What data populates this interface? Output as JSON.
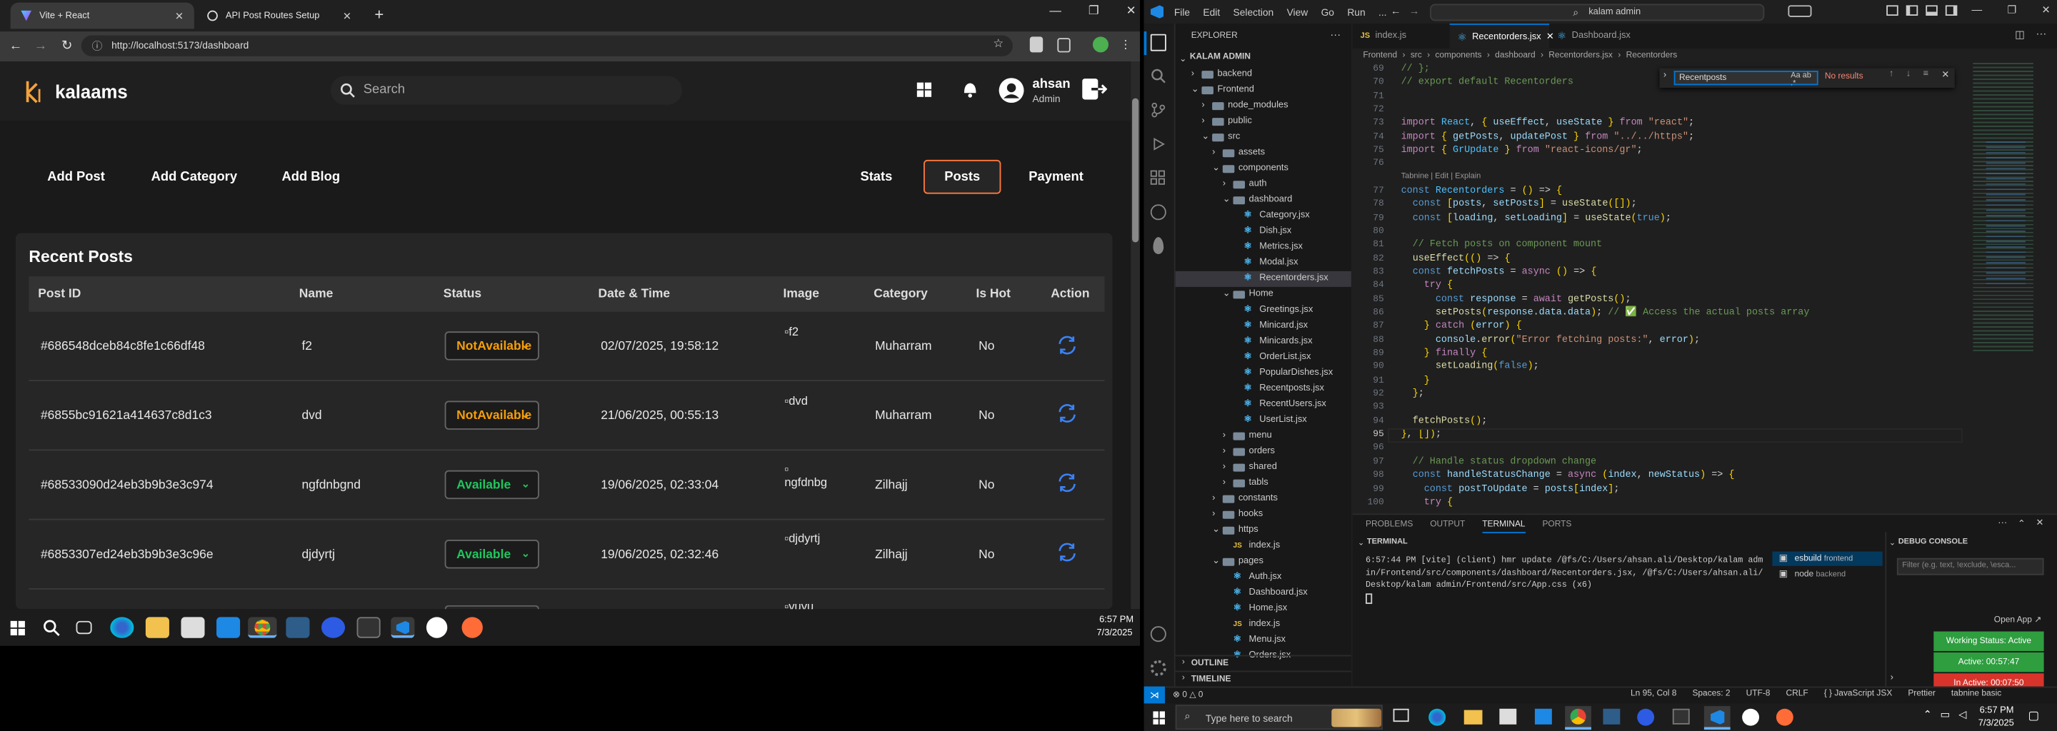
{
  "browser": {
    "tabs": [
      {
        "label": "Vite + React"
      },
      {
        "label": "API Post Routes Setup"
      }
    ],
    "url": "http://localhost:5173/dashboard"
  },
  "app": {
    "brand": "kalaams",
    "search_placeholder": "Search",
    "user_name": "ahsan",
    "user_role": "Admin",
    "left_nav": [
      "Add Post",
      "Add Category",
      "Add Blog"
    ],
    "right_nav": [
      "Stats",
      "Posts",
      "Payment"
    ],
    "active_nav": "Posts",
    "section_title": "Recent Posts",
    "columns": [
      "Post ID",
      "Name",
      "Status",
      "Date & Time",
      "Image",
      "Category",
      "Is Hot",
      "Action"
    ],
    "rows": [
      {
        "id": "#686548dceb84c8fe1c66df48",
        "name": "f2",
        "status": "NotAvailable",
        "datetime": "02/07/2025, 19:58:12",
        "image_alt": "f2",
        "category": "Muharram",
        "hot": "No"
      },
      {
        "id": "#6855bc91621a414637c8d1c3",
        "name": "dvd",
        "status": "NotAvailable",
        "datetime": "21/06/2025, 00:55:13",
        "image_alt": "dvd",
        "category": "Muharram",
        "hot": "No"
      },
      {
        "id": "#68533090d24eb3b9b3e3c974",
        "name": "ngfdnbgnd",
        "status": "Available",
        "datetime": "19/06/2025, 02:33:04",
        "image_alt": "ngfdnbg",
        "category": "Zilhajj",
        "hot": "No"
      },
      {
        "id": "#6853307ed24eb3b9b3e3c96e",
        "name": "djdyrtj",
        "status": "Available",
        "datetime": "19/06/2025, 02:32:46",
        "image_alt": "djdyrtj",
        "category": "Zilhajj",
        "hot": "No"
      }
    ],
    "partial_row_image_alt": "yuyu",
    "colors": {
      "available": "#22c55e",
      "not_available": "#f59e0b",
      "accent": "#ff7a3d",
      "refresh": "#3b82f6"
    }
  },
  "taskbar_left": {
    "time": "6:57 PM",
    "date": "7/3/2025"
  },
  "vscode": {
    "menu": [
      "File",
      "Edit",
      "Selection",
      "View",
      "Go",
      "Run",
      "..."
    ],
    "search": "kalam admin",
    "tabs": [
      {
        "label": "index.js"
      },
      {
        "label": "Recentorders.jsx"
      },
      {
        "label": "Dashboard.jsx"
      }
    ],
    "breadcrumb": [
      "Frontend",
      "src",
      "components",
      "dashboard",
      "Recentorders.jsx",
      "Recentorders"
    ],
    "explorer_title": "EXPLORER",
    "root": "KALAM ADMIN",
    "tree": [
      {
        "label": "backend",
        "depth": 1,
        "kind": "folder",
        "open": false
      },
      {
        "label": "Frontend",
        "depth": 1,
        "kind": "folder",
        "open": true
      },
      {
        "label": "node_modules",
        "depth": 2,
        "kind": "folder",
        "open": false
      },
      {
        "label": "public",
        "depth": 2,
        "kind": "folder",
        "open": false
      },
      {
        "label": "src",
        "depth": 2,
        "kind": "folder",
        "open": true
      },
      {
        "label": "assets",
        "depth": 3,
        "kind": "folder",
        "open": false
      },
      {
        "label": "components",
        "depth": 3,
        "kind": "folder",
        "open": true
      },
      {
        "label": "auth",
        "depth": 4,
        "kind": "folder",
        "open": false
      },
      {
        "label": "dashboard",
        "depth": 4,
        "kind": "folder",
        "open": true
      },
      {
        "label": "Category.jsx",
        "depth": 5,
        "kind": "file"
      },
      {
        "label": "Dish.jsx",
        "depth": 5,
        "kind": "file"
      },
      {
        "label": "Metrics.jsx",
        "depth": 5,
        "kind": "file"
      },
      {
        "label": "Modal.jsx",
        "depth": 5,
        "kind": "file"
      },
      {
        "label": "Recentorders.jsx",
        "depth": 5,
        "kind": "file",
        "selected": true
      },
      {
        "label": "Home",
        "depth": 4,
        "kind": "folder",
        "open": true
      },
      {
        "label": "Greetings.jsx",
        "depth": 5,
        "kind": "file"
      },
      {
        "label": "Minicard.jsx",
        "depth": 5,
        "kind": "file"
      },
      {
        "label": "Minicards.jsx",
        "depth": 5,
        "kind": "file"
      },
      {
        "label": "OrderList.jsx",
        "depth": 5,
        "kind": "file"
      },
      {
        "label": "PopularDishes.jsx",
        "depth": 5,
        "kind": "file"
      },
      {
        "label": "Recentposts.jsx",
        "depth": 5,
        "kind": "file"
      },
      {
        "label": "RecentUsers.jsx",
        "depth": 5,
        "kind": "file"
      },
      {
        "label": "UserList.jsx",
        "depth": 5,
        "kind": "file"
      },
      {
        "label": "menu",
        "depth": 4,
        "kind": "folder",
        "open": false
      },
      {
        "label": "orders",
        "depth": 4,
        "kind": "folder",
        "open": false
      },
      {
        "label": "shared",
        "depth": 4,
        "kind": "folder",
        "open": false
      },
      {
        "label": "tabls",
        "depth": 4,
        "kind": "folder",
        "open": false
      },
      {
        "label": "constants",
        "depth": 3,
        "kind": "folder",
        "open": false
      },
      {
        "label": "hooks",
        "depth": 3,
        "kind": "folder",
        "open": false
      },
      {
        "label": "https",
        "depth": 3,
        "kind": "folder",
        "open": true
      },
      {
        "label": "index.js",
        "depth": 4,
        "kind": "file"
      },
      {
        "label": "pages",
        "depth": 3,
        "kind": "folder",
        "open": true
      },
      {
        "label": "Auth.jsx",
        "depth": 4,
        "kind": "file"
      },
      {
        "label": "Dashboard.jsx",
        "depth": 4,
        "kind": "file"
      },
      {
        "label": "Home.jsx",
        "depth": 4,
        "kind": "file"
      },
      {
        "label": "index.js",
        "depth": 4,
        "kind": "file"
      },
      {
        "label": "Menu.jsx",
        "depth": 4,
        "kind": "file"
      },
      {
        "label": "Orders.jsx",
        "depth": 4,
        "kind": "file"
      }
    ],
    "outline": "OUTLINE",
    "timeline": "TIMELINE",
    "find": {
      "value": "Recentposts",
      "result": "No results"
    },
    "codelens": "Tabnine | Edit | Explain",
    "code": [
      {
        "n": "69",
        "t": "// };"
      },
      {
        "n": "70",
        "t": "// export default Recentorders"
      },
      {
        "n": "71",
        "t": ""
      },
      {
        "n": "72",
        "t": ""
      },
      {
        "n": "73",
        "t": "import React, { useEffect, useState } from \"react\";"
      },
      {
        "n": "74",
        "t": "import { getPosts, updatePost } from \"../../https\";"
      },
      {
        "n": "75",
        "t": "import { GrUpdate } from \"react-icons/gr\";"
      },
      {
        "n": "76",
        "t": ""
      },
      {
        "n": "77",
        "t": "const Recentorders = () => {"
      },
      {
        "n": "78",
        "t": "  const [posts, setPosts] = useState([]);"
      },
      {
        "n": "79",
        "t": "  const [loading, setLoading] = useState(true);"
      },
      {
        "n": "80",
        "t": ""
      },
      {
        "n": "81",
        "t": "  // Fetch posts on component mount"
      },
      {
        "n": "82",
        "t": "  useEffect(() => {"
      },
      {
        "n": "83",
        "t": "  const fetchPosts = async () => {"
      },
      {
        "n": "84",
        "t": "    try {"
      },
      {
        "n": "85",
        "t": "      const response = await getPosts();"
      },
      {
        "n": "86",
        "t": "      setPosts(response.data.data); // ✅ Access the actual posts array"
      },
      {
        "n": "87",
        "t": "    } catch (error) {"
      },
      {
        "n": "88",
        "t": "      console.error(\"Error fetching posts:\", error);"
      },
      {
        "n": "89",
        "t": "    } finally {"
      },
      {
        "n": "90",
        "t": "      setLoading(false);"
      },
      {
        "n": "91",
        "t": "    }"
      },
      {
        "n": "92",
        "t": "  };"
      },
      {
        "n": "93",
        "t": ""
      },
      {
        "n": "94",
        "t": "  fetchPosts();"
      },
      {
        "n": "95",
        "t": "}, []);"
      },
      {
        "n": "96",
        "t": ""
      },
      {
        "n": "97",
        "t": "  // Handle status dropdown change"
      },
      {
        "n": "98",
        "t": "  const handleStatusChange = async (index, newStatus) => {"
      },
      {
        "n": "99",
        "t": "    const postToUpdate = posts[index];"
      },
      {
        "n": "100",
        "t": "    try {"
      }
    ],
    "panel_tabs": [
      "PROBLEMS",
      "OUTPUT",
      "TERMINAL",
      "PORTS"
    ],
    "terminal_title": "TERMINAL",
    "terminal_lines": [
      "6:57:44 PM [vite] (client) hmr update /@fs/C:/Users/ahsan.ali/Desktop/kalam adm",
      "in/Frontend/src/components/dashboard/Recentorders.jsx, /@fs/C:/Users/ahsan.ali/",
      "Desktop/kalam admin/Frontend/src/App.css (x6)"
    ],
    "terminals": [
      {
        "name": "esbuild",
        "cwd": "frontend"
      },
      {
        "name": "node",
        "cwd": "backend"
      }
    ],
    "debug_title": "DEBUG CONSOLE",
    "debug_filter": "Filter (e.g. text, !exclude, \\esca...",
    "open_app": "Open App ↗",
    "working_status": "Working Status: Active",
    "active_time": "Active: 00:57:47",
    "inactive_time": "In Active: 00:07:50",
    "status": {
      "problems": "⊗ 0 △ 0",
      "ln_col": "Ln 95, Col 8",
      "spaces": "Spaces: 2",
      "encoding": "UTF-8",
      "eol": "CRLF",
      "lang": "{ } JavaScript JSX",
      "prettier": "Prettier",
      "tabnine": "tabnine basic"
    }
  },
  "taskbar_right": {
    "search_placeholder": "Type here to search",
    "time": "6:57 PM",
    "date": "7/3/2025"
  }
}
